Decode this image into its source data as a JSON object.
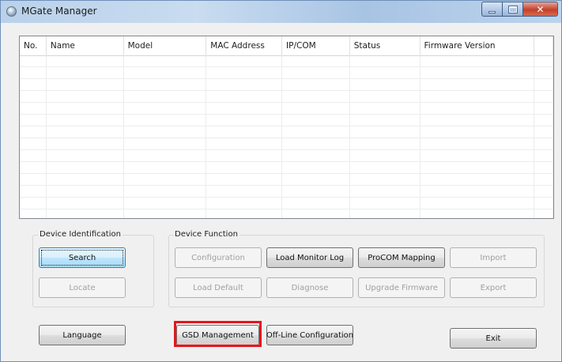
{
  "window": {
    "title": "MGate Manager"
  },
  "list": {
    "columns": [
      "No.",
      "Name",
      "Model",
      "MAC Address",
      "IP/COM",
      "Status",
      "Firmware Version",
      ""
    ],
    "empty_rows": 16
  },
  "device_identification": {
    "label": "Device Identification",
    "search": "Search",
    "locate": "Locate"
  },
  "device_function": {
    "label": "Device Function",
    "configuration": "Configuration",
    "load_monitor_log": "Load Monitor Log",
    "procom_mapping": "ProCOM Mapping",
    "import": "Import",
    "load_default": "Load Default",
    "diagnose": "Diagnose",
    "upgrade_firmware": "Upgrade Firmware",
    "export": "Export"
  },
  "bottom": {
    "language": "Language",
    "gsd_management": "GSD Management",
    "offline_configuration": "Off-Line Configuration",
    "exit": "Exit"
  },
  "colors": {
    "highlight": "#e8141b",
    "focus": "#3c7fb1"
  }
}
